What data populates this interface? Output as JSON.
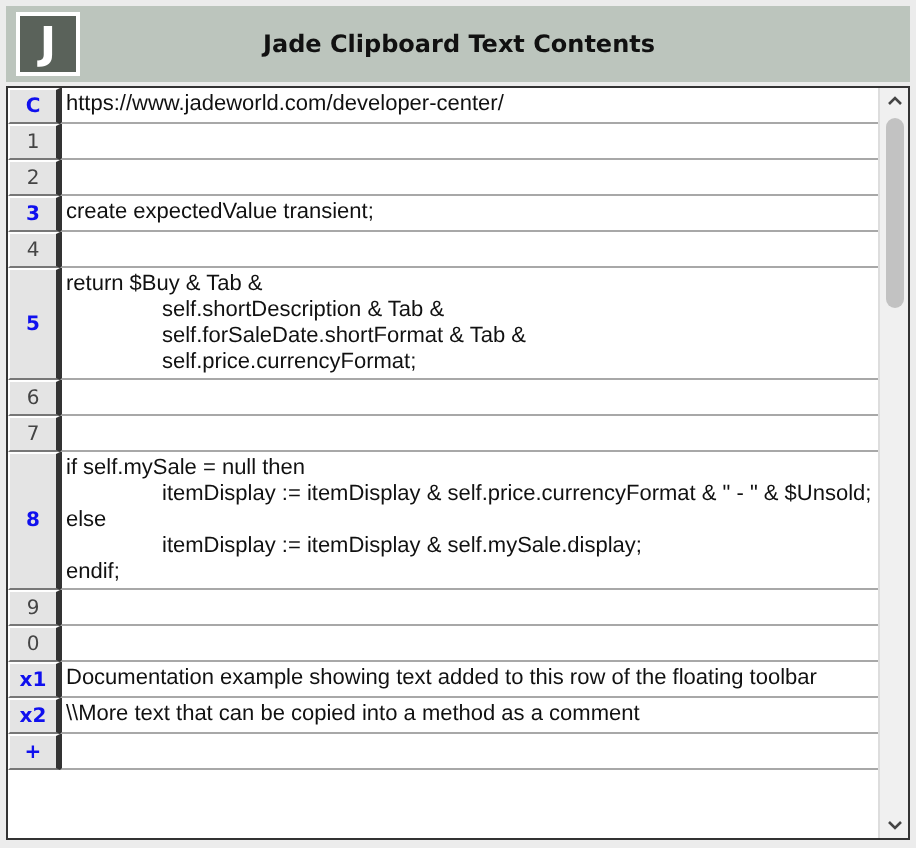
{
  "window": {
    "title": "Jade Clipboard Text Contents",
    "logo": "J"
  },
  "rows": [
    {
      "label": "C",
      "active": true,
      "text": "https://www.jadeworld.com/developer-center/"
    },
    {
      "label": "1",
      "active": false,
      "text": ""
    },
    {
      "label": "2",
      "active": false,
      "text": ""
    },
    {
      "label": "3",
      "active": true,
      "text": "create expectedValue transient;"
    },
    {
      "label": "4",
      "active": false,
      "text": ""
    },
    {
      "label": "5",
      "active": true,
      "text": "return $Buy & Tab &\n\tself.shortDescription & Tab &\n\tself.forSaleDate.shortFormat & Tab &\n\tself.price.currencyFormat;"
    },
    {
      "label": "6",
      "active": false,
      "text": ""
    },
    {
      "label": "7",
      "active": false,
      "text": ""
    },
    {
      "label": "8",
      "active": true,
      "text": "if self.mySale = null then\n\titemDisplay := itemDisplay & self.price.currencyFormat & \" - \" & $Unsold;\nelse\n\titemDisplay := itemDisplay & self.mySale.display;\nendif;"
    },
    {
      "label": "9",
      "active": false,
      "text": ""
    },
    {
      "label": "0",
      "active": false,
      "text": ""
    },
    {
      "label": "x1",
      "active": true,
      "text": "Documentation example showing text added to this row of the floating toolbar"
    },
    {
      "label": "x2",
      "active": true,
      "text": "\\\\More text that can be copied into a method as a comment"
    },
    {
      "label": "+",
      "active": true,
      "text": ""
    }
  ]
}
